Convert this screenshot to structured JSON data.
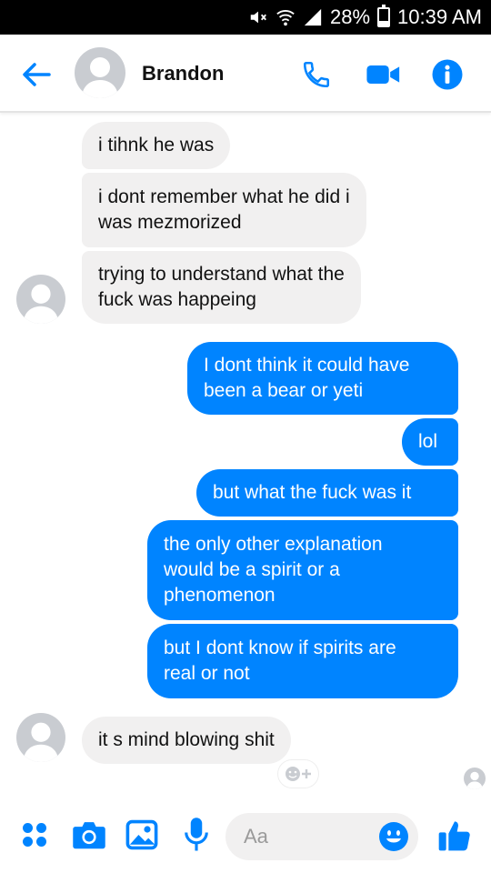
{
  "status_bar": {
    "battery": "28%",
    "battery_level": 0.28,
    "time": "10:39 AM"
  },
  "header": {
    "contact_name": "Brandon"
  },
  "messages": [
    {
      "side": "in",
      "text_lines": [
        "i tihnk he was"
      ]
    },
    {
      "side": "in",
      "text_lines": [
        "i dont remember what he did i",
        "was mezmorized"
      ]
    },
    {
      "side": "in",
      "text_lines": [
        "trying to understand what the",
        "fuck was happeing"
      ]
    },
    {
      "side": "out",
      "text_lines": [
        "I dont think it could have",
        "been a bear or yeti"
      ]
    },
    {
      "side": "out",
      "text_lines": [
        "lol"
      ]
    },
    {
      "side": "out",
      "text_lines": [
        "but what the fuck was it"
      ]
    },
    {
      "side": "out",
      "text_lines": [
        "the only other explanation",
        "would be a spirit or a",
        "phenomenon"
      ]
    },
    {
      "side": "out",
      "text_lines": [
        "but I dont know if spirits are",
        "real or not"
      ]
    },
    {
      "side": "in",
      "text_lines": [
        "it s mind blowing shit"
      ]
    }
  ],
  "composer": {
    "placeholder": "Aa"
  },
  "colors": {
    "accent": "#0084ff",
    "incoming_bubble": "#f1f0f0",
    "emoji": "#0084ff"
  },
  "icons": {
    "back": "arrow-left-icon",
    "call": "phone-icon",
    "video": "video-camera-icon",
    "info": "info-icon",
    "more": "four-dots-icon",
    "camera": "camera-icon",
    "gallery": "image-icon",
    "mic": "microphone-icon",
    "emoji": "smiley-icon",
    "like": "thumbs-up-icon",
    "react": "add-reaction-icon"
  }
}
